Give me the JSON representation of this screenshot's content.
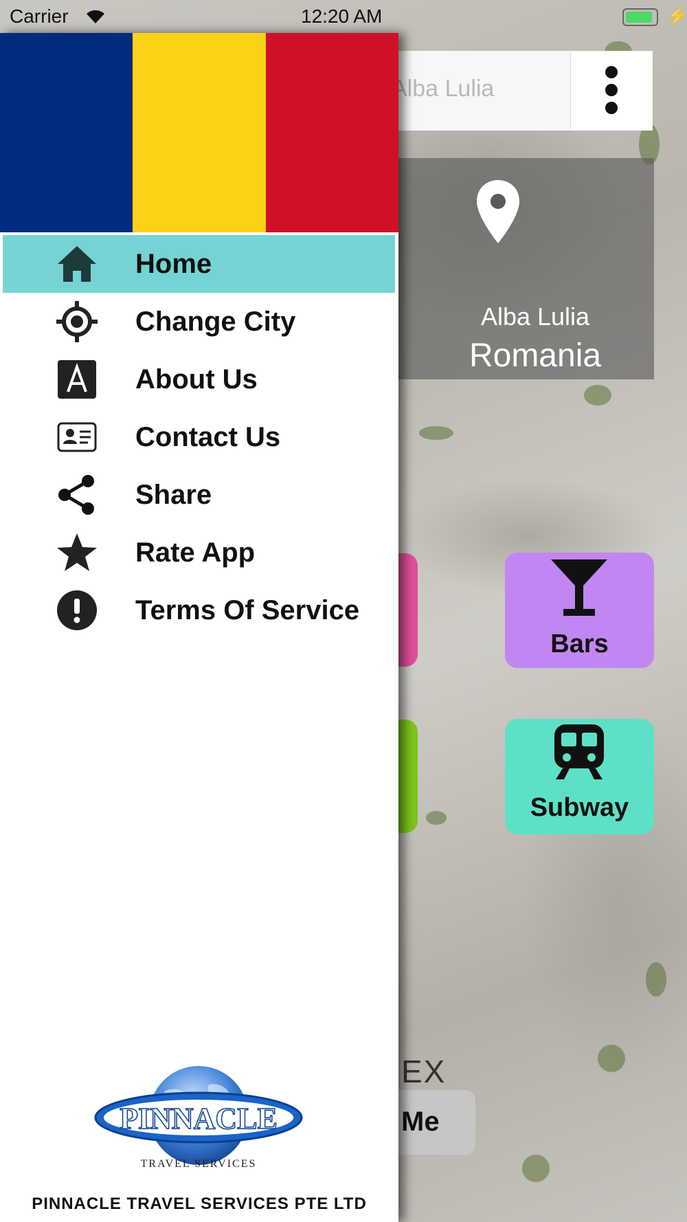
{
  "status_bar": {
    "carrier": "Carrier",
    "time": "12:20 AM"
  },
  "search": {
    "value": "Alba Lulia"
  },
  "location": {
    "city": "Alba Lulia",
    "country": "Romania"
  },
  "tiles": {
    "bars": "Bars",
    "subway": "Subway"
  },
  "partial": {
    "ex": "EX",
    "me": "Me"
  },
  "drawer": {
    "flag_colors": [
      "#002B7F",
      "#FCD116",
      "#CE1126"
    ],
    "items": [
      {
        "label": "Home",
        "icon": "home-icon",
        "active": true
      },
      {
        "label": "Change City",
        "icon": "gps-target-icon"
      },
      {
        "label": "About Us",
        "icon": "letter-a-icon"
      },
      {
        "label": "Contact Us",
        "icon": "contact-card-icon"
      },
      {
        "label": "Share",
        "icon": "share-icon"
      },
      {
        "label": "Rate App",
        "icon": "star-icon"
      },
      {
        "label": "Terms Of Service",
        "icon": "exclamation-icon"
      }
    ],
    "logo": {
      "name": "PINNACLE",
      "tagline": "TRAVEL SERVICES"
    },
    "company": "PINNACLE TRAVEL SERVICES PTE LTD"
  },
  "colors": {
    "active_item": "#75d4d3",
    "bars_tile": "#c286f2",
    "subway_tile": "#5ee0c7"
  }
}
